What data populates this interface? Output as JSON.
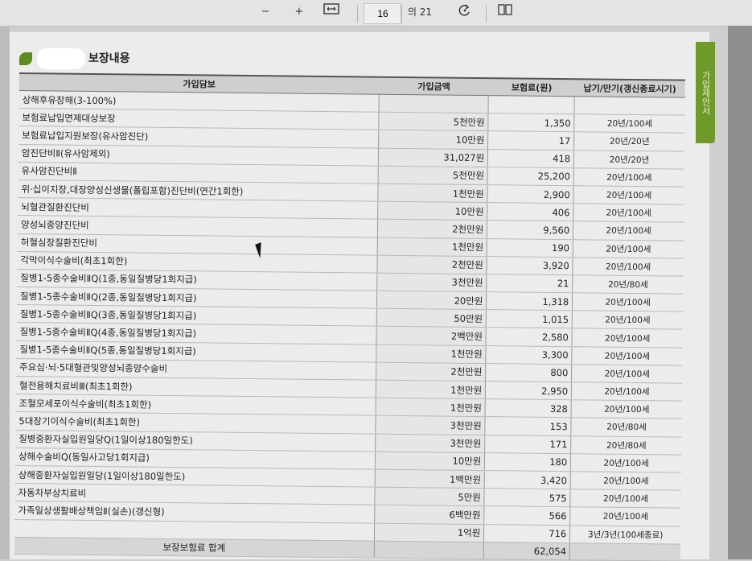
{
  "toolbar": {
    "title": "",
    "zoom_out": "−",
    "zoom_in": "+",
    "page_current": "16",
    "page_total": "의 21",
    "fit_icon": "fit-width-icon",
    "rotate_icon": "rotate-icon",
    "view_icon": "two-page-view-icon"
  },
  "section": {
    "title": "보장내용"
  },
  "side_tab": {
    "label": "가입제안서"
  },
  "table": {
    "headers": {
      "coverage": "가입담보",
      "amount": "가입금액",
      "premium": "보험료(원)",
      "term": "납기/만기(갱신종료시기)"
    },
    "rows": [
      {
        "name": "상해후유장해(3-100%)",
        "amount": "",
        "premium": "",
        "term": ""
      },
      {
        "name": "보험료납입면제대상보장",
        "amount": "5천만원",
        "premium": "1,350",
        "term": "20년/100세"
      },
      {
        "name": "보험료납입지원보장(유사암진단)",
        "amount": "10만원",
        "premium": "17",
        "term": "20년/20년"
      },
      {
        "name": "암진단비Ⅱ(유사암제외)",
        "amount": "31,027원",
        "premium": "418",
        "term": "20년/20년"
      },
      {
        "name": "유사암진단비Ⅱ",
        "amount": "5천만원",
        "premium": "25,200",
        "term": "20년/100세"
      },
      {
        "name": "위·십이지장,대장양성신생물(폴립포함)진단비(연간1회한)",
        "amount": "1천만원",
        "premium": "2,900",
        "term": "20년/100세"
      },
      {
        "name": "뇌혈관질환진단비",
        "amount": "10만원",
        "premium": "406",
        "term": "20년/100세"
      },
      {
        "name": "양성뇌종양진단비",
        "amount": "2천만원",
        "premium": "9,560",
        "term": "20년/100세"
      },
      {
        "name": "허혈심장질환진단비",
        "amount": "1천만원",
        "premium": "190",
        "term": "20년/100세"
      },
      {
        "name": "각막이식수술비(최초1회한)",
        "amount": "2천만원",
        "premium": "3,920",
        "term": "20년/100세"
      },
      {
        "name": "질병1-5종수술비ⅡQ(1종,동일질병당1회지급)",
        "amount": "3천만원",
        "premium": "21",
        "term": "20년/80세"
      },
      {
        "name": "질병1-5종수술비ⅡQ(2종,동일질병당1회지급)",
        "amount": "20만원",
        "premium": "1,318",
        "term": "20년/100세"
      },
      {
        "name": "질병1-5종수술비ⅡQ(3종,동일질병당1회지급)",
        "amount": "50만원",
        "premium": "1,015",
        "term": "20년/100세"
      },
      {
        "name": "질병1-5종수술비ⅡQ(4종,동일질병당1회지급)",
        "amount": "2백만원",
        "premium": "2,580",
        "term": "20년/100세"
      },
      {
        "name": "질병1-5종수술비ⅡQ(5종,동일질병당1회지급)",
        "amount": "1천만원",
        "premium": "3,300",
        "term": "20년/100세"
      },
      {
        "name": "주요심·뇌·5대혈관및양성뇌종양수술비",
        "amount": "2천만원",
        "premium": "800",
        "term": "20년/100세"
      },
      {
        "name": "혈전용해치료비Ⅲ(최초1회한)",
        "amount": "1천만원",
        "premium": "2,950",
        "term": "20년/100세"
      },
      {
        "name": "조혈모세포이식수술비(최초1회한)",
        "amount": "1천만원",
        "premium": "328",
        "term": "20년/100세"
      },
      {
        "name": "5대장기이식수술비(최초1회한)",
        "amount": "3천만원",
        "premium": "153",
        "term": "20년/80세"
      },
      {
        "name": "질병중환자실입원일당Q(1일이상180일한도)",
        "amount": "3천만원",
        "premium": "171",
        "term": "20년/80세"
      },
      {
        "name": "상해수술비Q(동일사고당1회지급)",
        "amount": "10만원",
        "premium": "180",
        "term": "20년/100세"
      },
      {
        "name": "상해중환자실입원일당(1일이상180일한도)",
        "amount": "1백만원",
        "premium": "3,420",
        "term": "20년/100세"
      },
      {
        "name": "자동차부상치료비",
        "amount": "5만원",
        "premium": "575",
        "term": "20년/100세"
      },
      {
        "name": "가족일상생활배상책임Ⅱ(실손)(갱신형)",
        "amount": "6백만원",
        "premium": "566",
        "term": "20년/100세"
      },
      {
        "name": "",
        "amount": "1억원",
        "premium": "716",
        "term": "3년/3년(100세종료)"
      }
    ],
    "total_label": "보장보험료 합계",
    "total_value": "62,054"
  }
}
